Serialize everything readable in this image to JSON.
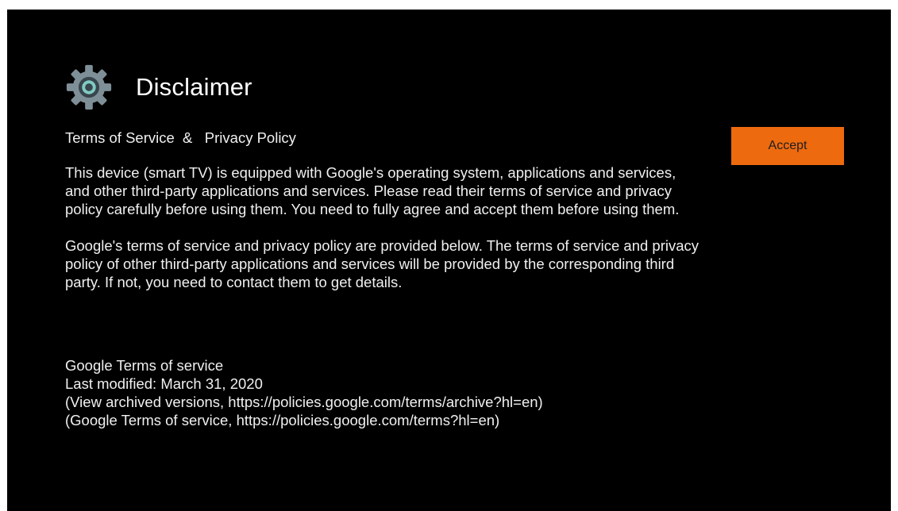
{
  "header": {
    "icon": "settings-gear-icon",
    "title": "Disclaimer"
  },
  "content": {
    "subtitle": "Terms of Service  &   Privacy Policy",
    "paragraphs": [
      "This device (smart TV) is equipped with Google's operating system, applications and services, and other third-party applications and services. Please read their terms of service and privacy policy carefully before using them. You need to fully agree and accept them before using them.",
      "Google's terms of service and privacy policy are provided below. The terms of service and privacy policy of other third-party applications and services will be provided by the corresponding third party. If not, you need to contact them to get details."
    ],
    "policy": {
      "heading": "Google Terms of service",
      "last_modified": "Last modified: March 31, 2020",
      "archive_link": "(View archived versions, https://policies.google.com/terms/archive?hl=en)",
      "terms_link": "(Google Terms of service, https://policies.google.com/terms?hl=en)"
    }
  },
  "actions": {
    "accept_label": "Accept"
  },
  "colors": {
    "background": "#000000",
    "accent": "#ee6a0f",
    "text": "#f0f0f0"
  }
}
